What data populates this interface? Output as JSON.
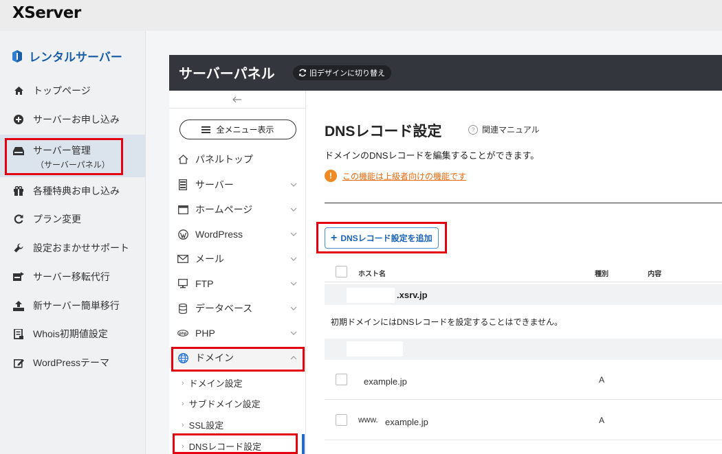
{
  "brand": {
    "logo": "XServer"
  },
  "sidebar": {
    "title": "レンタルサーバー",
    "items": [
      {
        "label": "トップページ",
        "icon": "home-icon"
      },
      {
        "label": "サーバーお申し込み",
        "icon": "plus-circle-icon"
      },
      {
        "label": "サーバー管理",
        "sub": "（サーバーパネル）",
        "icon": "server-icon",
        "active": true
      },
      {
        "label": "各種特典お申し込み",
        "icon": "gift-icon"
      },
      {
        "label": "プラン変更",
        "icon": "refresh-icon"
      },
      {
        "label": "設定おまかせサポート",
        "icon": "wrench-icon"
      },
      {
        "label": "サーバー移転代行",
        "icon": "server-move-icon"
      },
      {
        "label": "新サーバー簡単移行",
        "icon": "upload-icon"
      },
      {
        "label": "Whois初期値設定",
        "icon": "whois-icon"
      },
      {
        "label": "WordPressテーマ",
        "icon": "edit-icon"
      }
    ]
  },
  "panel": {
    "title": "サーバーパネル",
    "switch_label": "旧デザインに切り替え"
  },
  "nav": {
    "back_icon": "arrow-left-icon",
    "menu_button": "全メニュー表示",
    "items": [
      {
        "label": "パネルトップ",
        "icon": "home-icon"
      },
      {
        "label": "サーバー",
        "icon": "server-icon"
      },
      {
        "label": "ホームページ",
        "icon": "browser-icon"
      },
      {
        "label": "WordPress",
        "icon": "wordpress-icon"
      },
      {
        "label": "メール",
        "icon": "mail-icon"
      },
      {
        "label": "FTP",
        "icon": "monitor-icon"
      },
      {
        "label": "データベース",
        "icon": "database-icon"
      },
      {
        "label": "PHP",
        "icon": "php-icon"
      },
      {
        "label": "ドメイン",
        "icon": "globe-icon",
        "expanded": true
      }
    ],
    "sub_items": [
      "ドメイン設定",
      "サブドメイン設定",
      "SSL設定",
      "DNSレコード設定"
    ]
  },
  "content": {
    "title": "DNSレコード設定",
    "manual_link": "関連マニュアル",
    "description": "ドメインのDNSレコードを編集することができます。",
    "warning": "この機能は上級者向けの機能です",
    "add_button": "DNSレコード設定を追加",
    "table": {
      "headers": {
        "host": "ホスト名",
        "type": "種別",
        "content": "内容"
      },
      "domain_suffix": ".xsrv.jp",
      "note": "初期ドメインにはDNSレコードを設定することはできません。",
      "rows": [
        {
          "prefix": "",
          "host": "example.jp",
          "type": "A"
        },
        {
          "prefix": "www.",
          "host": "example.jp",
          "type": "A"
        }
      ]
    }
  },
  "colors": {
    "accent": "#1a5ea8",
    "highlight": "#e3000f",
    "warning": "#e8690b",
    "header_bg": "#33373d"
  }
}
